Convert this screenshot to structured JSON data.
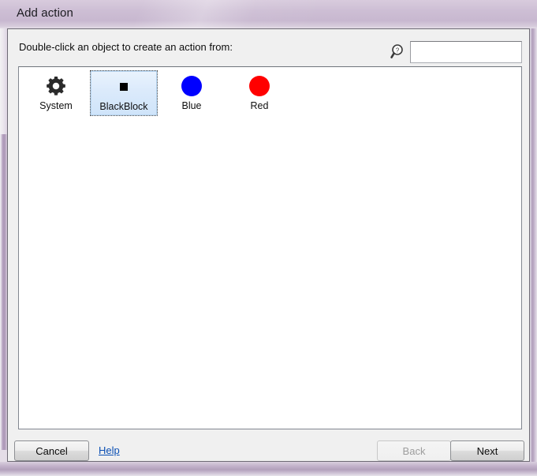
{
  "window": {
    "title": "Add action",
    "frame_color": "#cdbed4",
    "client_bg": "#f0f0f0"
  },
  "body": {
    "prompt": "Double-click an object to create an action from:"
  },
  "search": {
    "icon": "magnifier-question-icon",
    "value": "",
    "placeholder": ""
  },
  "objects": {
    "items": [
      {
        "label": "System",
        "icon": "gear-icon",
        "selected": false
      },
      {
        "label": "BlackBlock",
        "icon": "black-square-icon",
        "selected": true
      },
      {
        "label": "Blue",
        "icon": "blue-circle-icon",
        "selected": false,
        "color": "#0000ff"
      },
      {
        "label": "Red",
        "icon": "red-circle-icon",
        "selected": false,
        "color": "#ff0000"
      }
    ]
  },
  "footer": {
    "cancel_label": "Cancel",
    "help_label": "Help",
    "back_label": "Back",
    "next_label": "Next",
    "back_enabled": false,
    "next_enabled": true,
    "link_color": "#0b4fb4"
  }
}
